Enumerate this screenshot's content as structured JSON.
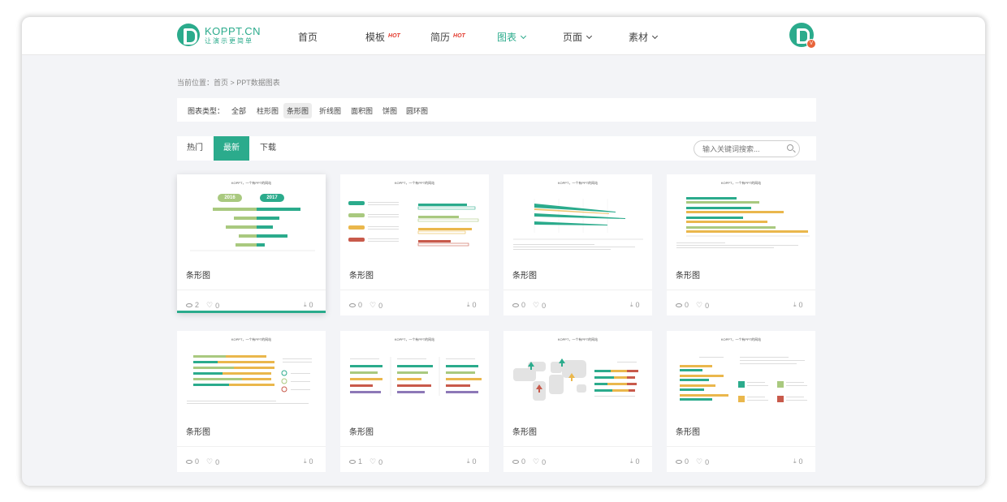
{
  "header": {
    "logo_name": "KOPPT.CN",
    "logo_slogan": "让演示更简单",
    "nav": [
      {
        "label": "首页",
        "hot": "",
        "dropdown": false,
        "active": false
      },
      {
        "label": "模板",
        "hot": "HOT",
        "dropdown": false,
        "active": false
      },
      {
        "label": "简历",
        "hot": "HOT",
        "dropdown": false,
        "active": false
      },
      {
        "label": "图表",
        "hot": "",
        "dropdown": true,
        "active": true
      },
      {
        "label": "页面",
        "hot": "",
        "dropdown": true,
        "active": false
      },
      {
        "label": "素材",
        "hot": "",
        "dropdown": true,
        "active": false
      }
    ],
    "avatar_badge": "V"
  },
  "breadcrumb": "当前位置：首页 > PPT数据图表",
  "filter": {
    "label": "图表类型：",
    "options": [
      "全部",
      "柱形图",
      "条形图",
      "折线图",
      "面积图",
      "饼图",
      "圆环图"
    ],
    "selected": "条形图"
  },
  "tabs": [
    "热门",
    "最新",
    "下载"
  ],
  "active_tab": "最新",
  "search": {
    "placeholder": "输入关键词搜索..."
  },
  "colors": {
    "accent": "#2bab8c",
    "hot": "#e23b2e",
    "bar_green": "#a9c97f",
    "bar_teal": "#2bab8c",
    "bar_yellow": "#eab74c",
    "bar_red": "#c85a4b",
    "bar_purple": "#8d78b7"
  },
  "cards": [
    {
      "title": "条形图",
      "views": "2",
      "likes": "0",
      "downloads": "0",
      "thumb_title": "KOPPT，一个有PPT的网站",
      "years": [
        "2016",
        "2017"
      ]
    },
    {
      "title": "条形图",
      "views": "0",
      "likes": "0",
      "downloads": "0",
      "thumb_title": "KOPPT，一个有PPT的网站"
    },
    {
      "title": "条形图",
      "views": "0",
      "likes": "0",
      "downloads": "0",
      "thumb_title": "KOPPT，一个有PPT的网站"
    },
    {
      "title": "条形图",
      "views": "0",
      "likes": "0",
      "downloads": "0",
      "thumb_title": "KOPPT，一个有PPT的网站"
    },
    {
      "title": "条形图",
      "views": "0",
      "likes": "0",
      "downloads": "0",
      "thumb_title": "KOPPT，一个有PPT的网站"
    },
    {
      "title": "条形图",
      "views": "1",
      "likes": "0",
      "downloads": "0",
      "thumb_title": "KOPPT，一个有PPT的网站"
    },
    {
      "title": "条形图",
      "views": "0",
      "likes": "0",
      "downloads": "0",
      "thumb_title": "KOPPT，一个有PPT的网站"
    },
    {
      "title": "条形图",
      "views": "0",
      "likes": "0",
      "downloads": "0",
      "thumb_title": "KOPPT，一个有PPT的网站"
    }
  ]
}
